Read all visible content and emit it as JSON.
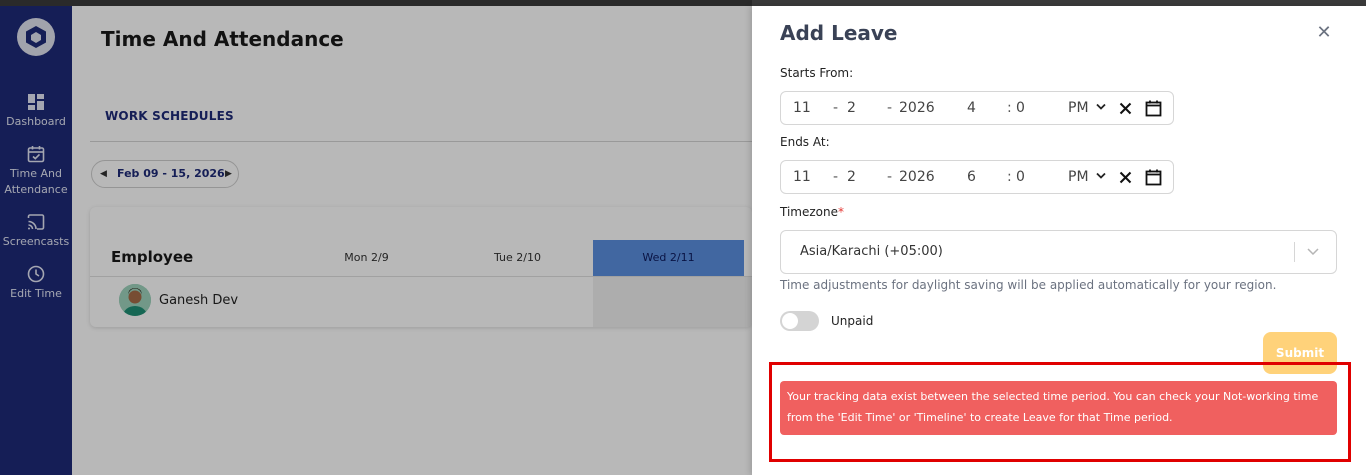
{
  "sidebar": {
    "items": [
      {
        "label": "Dashboard"
      },
      {
        "label": "Time And Attendance"
      },
      {
        "label": "Screencasts"
      },
      {
        "label": "Edit Time"
      }
    ]
  },
  "main": {
    "title": "Time And Attendance",
    "tab": "WORK SCHEDULES",
    "date_range": "Feb 09  -  15, 2026",
    "table": {
      "employee_header": "Employee",
      "days": [
        "Mon 2/9",
        "Tue 2/10",
        "Wed 2/11"
      ],
      "rows": [
        {
          "name": "Ganesh Dev"
        }
      ]
    }
  },
  "drawer": {
    "title": "Add Leave",
    "starts_label": "Starts From:",
    "starts": {
      "month": "11",
      "day": "2",
      "year": "2026",
      "hour": "4",
      "minute": "0",
      "ampm": "PM"
    },
    "ends_label": "Ends At:",
    "ends": {
      "month": "11",
      "day": "2",
      "year": "2026",
      "hour": "6",
      "minute": "0",
      "ampm": "PM"
    },
    "timezone_label": "Timezone",
    "timezone_value": "Asia/Karachi (+05:00)",
    "timezone_note": "Time adjustments for daylight saving will be applied automatically for your region.",
    "unpaid_label": "Unpaid",
    "submit_label": "Submit",
    "alert_text": "Your tracking data exist between the selected time period. You can check your Not-working time from the 'Edit Time' or 'Timeline' to create Leave for that Time period."
  },
  "colors": {
    "sidebar": "#1e2a78",
    "submit": "#ffd27a",
    "alert": "#f0605f",
    "highlight": "#e00000"
  }
}
